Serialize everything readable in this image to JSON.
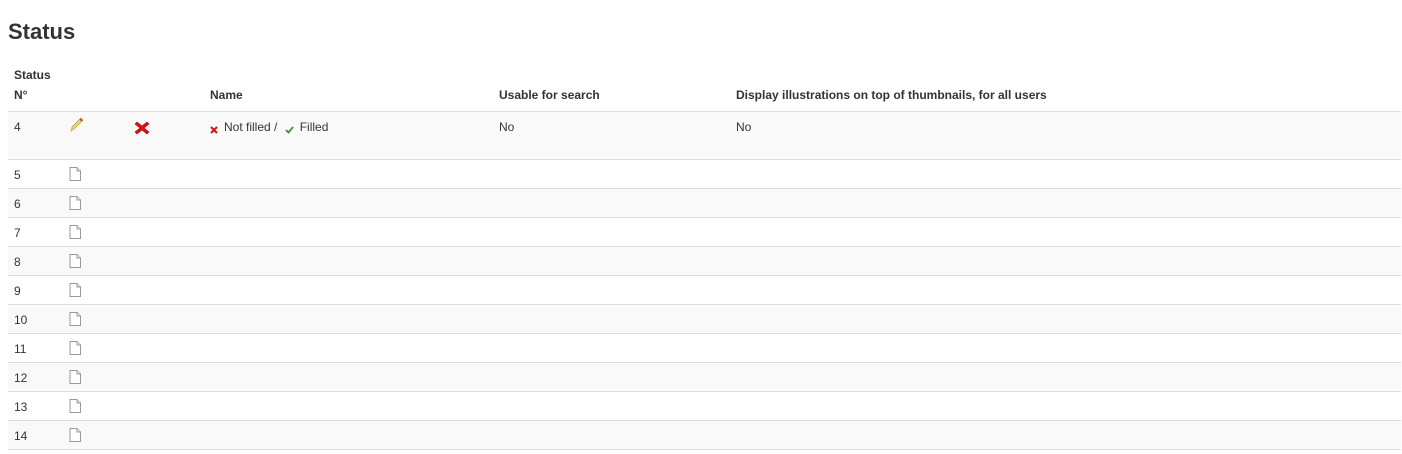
{
  "page": {
    "title": "Status"
  },
  "table": {
    "headers": {
      "status_line1": "Status",
      "status_line2": "N°",
      "name": "Name",
      "usable": "Usable for search",
      "display": "Display illustrations on top of thumbnails, for all users"
    },
    "main_row": {
      "number": "4",
      "edit_icon": "pencil-icon",
      "delete_icon": "red-x-icon",
      "not_filled_label": "Not filled /",
      "filled_label": "Filled",
      "usable": "No",
      "display": "No"
    },
    "empty_rows": [
      {
        "number": "5",
        "icon": "document-icon"
      },
      {
        "number": "6",
        "icon": "document-icon"
      },
      {
        "number": "7",
        "icon": "document-icon"
      },
      {
        "number": "8",
        "icon": "document-icon"
      },
      {
        "number": "9",
        "icon": "document-icon"
      },
      {
        "number": "10",
        "icon": "document-icon"
      },
      {
        "number": "11",
        "icon": "document-icon"
      },
      {
        "number": "12",
        "icon": "document-icon"
      },
      {
        "number": "13",
        "icon": "document-icon"
      },
      {
        "number": "14",
        "icon": "document-icon"
      }
    ]
  },
  "colors": {
    "text": "#333333",
    "row_stripe": "#f9f9f9",
    "border": "#dddddd",
    "delete_red": "#dd1111",
    "check_green": "#2e9e2e"
  }
}
